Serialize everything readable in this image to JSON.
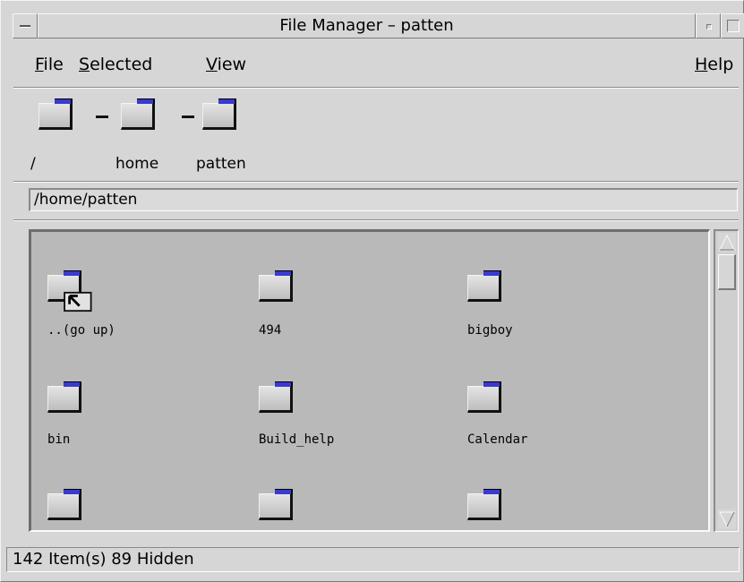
{
  "window": {
    "title": "File Manager – patten"
  },
  "menu": {
    "file": {
      "mnemonic": "F",
      "rest": "ile"
    },
    "selected": {
      "mnemonic": "S",
      "rest": "elected"
    },
    "view": {
      "mnemonic": "V",
      "rest": "iew"
    },
    "help": {
      "mnemonic": "H",
      "rest": "elp"
    }
  },
  "path_bar": {
    "segments": [
      {
        "label": "/"
      },
      {
        "label": "home"
      },
      {
        "label": "patten"
      }
    ]
  },
  "address": {
    "value": "/home/patten"
  },
  "files": [
    {
      "name": "..(go up)",
      "icon": "go-up-folder-icon"
    },
    {
      "name": "494",
      "icon": "folder-icon"
    },
    {
      "name": "bigboy",
      "icon": "folder-icon"
    },
    {
      "name": "bin",
      "icon": "folder-icon"
    },
    {
      "name": "Build_help",
      "icon": "folder-icon"
    },
    {
      "name": "Calendar",
      "icon": "folder-icon"
    },
    {
      "name": "",
      "icon": "folder-icon"
    },
    {
      "name": "",
      "icon": "folder-icon"
    },
    {
      "name": "",
      "icon": "folder-icon"
    }
  ],
  "status": {
    "text": "142 Item(s) 89 Hidden"
  },
  "colors": {
    "window_bg": "#d6d6d6",
    "pane_bg": "#b9b9b9",
    "folder_tab": "#3a3ad0"
  }
}
